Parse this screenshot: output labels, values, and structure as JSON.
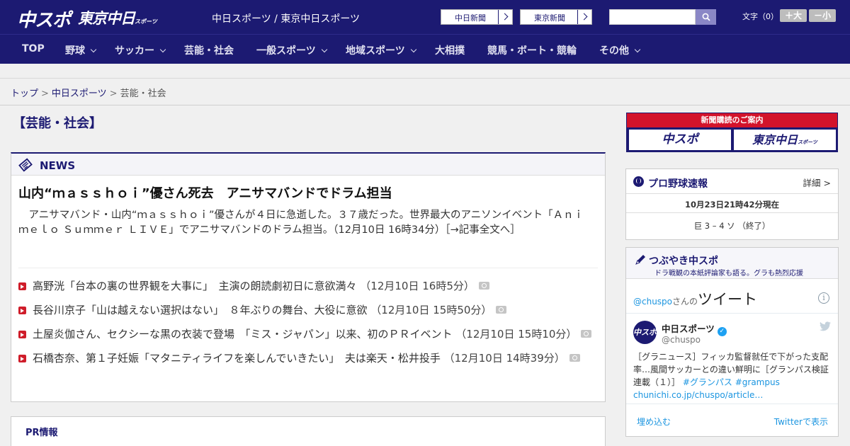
{
  "header": {
    "logo_chuspo": "中スポ",
    "logo_tokyo": "東京中日",
    "logo_tokyo_small": "スポーツ",
    "site_names": "中日スポーツ / 東京中日スポーツ",
    "paper_buttons": [
      "中日新聞",
      "東京新聞"
    ],
    "search_placeholder": "",
    "fontsize_label": "文字（0）",
    "font_larger": "＋大",
    "font_smaller": "－小"
  },
  "nav": {
    "items": [
      {
        "label": "TOP",
        "dropdown": false
      },
      {
        "label": "野球",
        "dropdown": true
      },
      {
        "label": "サッカー",
        "dropdown": true
      },
      {
        "label": "芸能・社会",
        "dropdown": false
      },
      {
        "label": "一般スポーツ",
        "dropdown": true
      },
      {
        "label": "地域スポーツ",
        "dropdown": true
      },
      {
        "label": "大相撲",
        "dropdown": false
      },
      {
        "label": "競馬・ボート・競輪",
        "dropdown": false
      },
      {
        "label": "その他",
        "dropdown": true
      }
    ]
  },
  "breadcrumb": {
    "home": "トップ",
    "sep": ">",
    "section": "中日スポーツ",
    "current": "芸能・社会"
  },
  "main": {
    "page_title": "【芸能・社会】",
    "news_label": "NEWS",
    "lead": {
      "title": "山内“ｍａｓｓｈｏｉ”優さん死去　アニサマバンドでドラム担当",
      "body": "アニサマバンド・山内“ｍａｓｓｈｏｉ”優さんが４日に急逝した。３７歳だった。世界最大のアニソンイベント「Ａｎｉｍｅｌｏ Ｓｕｍｍｅｒ ＬＩＶＥ」でアニサマバンドのドラム担当。（12月10日 16時34分）［→記事全文へ］"
    },
    "items": [
      {
        "title": "高野洸「台本の裏の世界観を大事に」　主演の朗読劇初日に意欲満々",
        "time": "（12月10日 16時5分）",
        "photo": true
      },
      {
        "title": "長谷川京子「山は越えない選択はない」　８年ぶりの舞台、大役に意欲",
        "time": "（12月10日 15時50分）",
        "photo": true
      },
      {
        "title": "土屋炎伽さん、セクシーな黒の衣装で登場　「ミス・ジャパン」以来、初のＰＲイベント",
        "time": "（12月10日 15時10分）",
        "photo": true
      },
      {
        "title": "石橋杏奈、第１子妊娠「マタニティライフを楽しんでいきたい」　夫は楽天・松井投手",
        "time": "（12月10日 14時39分）",
        "photo": true
      }
    ],
    "pr_label": "PR情報"
  },
  "sidebar": {
    "subscribe": {
      "strap": "新聞購読のご案内",
      "btn1": "中スポ",
      "btn2": "東京中日",
      "btn2_small": "スポーツ"
    },
    "baseball": {
      "title": "プロ野球速報",
      "more": "詳細 >",
      "time": "10月23日21時42分現在",
      "score": "巨 3 – 4 ソ （終了）"
    },
    "twitter": {
      "title": "つぶやき中スポ",
      "subtitle": "ドラ戦観の本紙評論家も語る。グラも熱烈応援",
      "widget_handle": "@chuspo",
      "widget_san": "さんの",
      "widget_tweet": "ツイート",
      "info": "i",
      "user_name": "中日スポーツ",
      "user_handle": "@chuspo",
      "avatar_text": "中スポ",
      "tweet_text": "［グラニュース］フィッカ監督就任で下がった支配率…風間サッカーとの違い鮮明に［グランパス検証連載（１）］",
      "tweet_tags": "#グランパス #grampus",
      "tweet_link": "chunichi.co.jp/chuspo/article…",
      "embed": "埋め込む",
      "view": "Twitterで表示"
    }
  }
}
